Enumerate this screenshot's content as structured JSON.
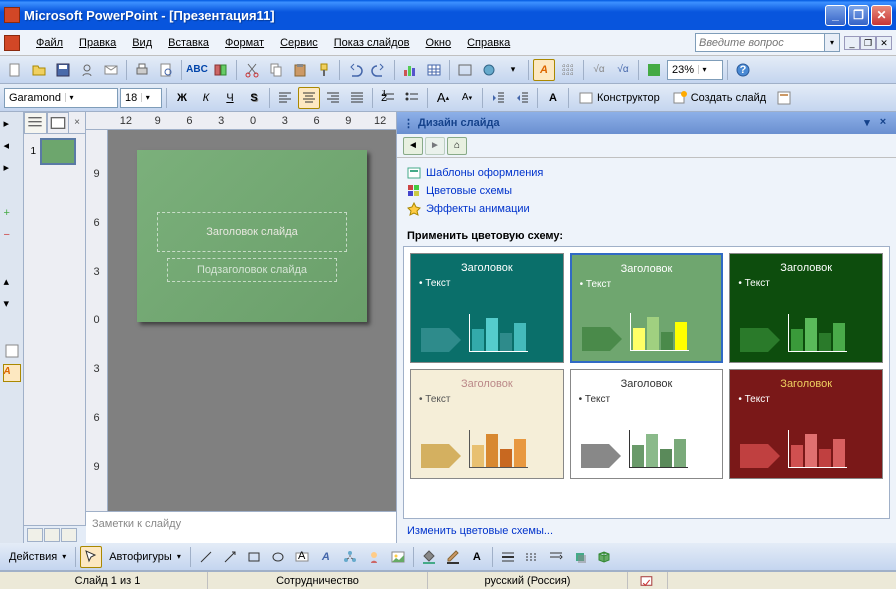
{
  "app": {
    "title": "Microsoft PowerPoint - [Презентация11]"
  },
  "menu": {
    "file": "Файл",
    "edit": "Правка",
    "view": "Вид",
    "insert": "Вставка",
    "format": "Формат",
    "service": "Сервис",
    "slideshow": "Показ слайдов",
    "window": "Окно",
    "help": "Справка"
  },
  "helpbox": {
    "placeholder": "Введите вопрос"
  },
  "toolbar": {
    "zoom": "23%",
    "constructor": "Конструктор",
    "new_slide": "Создать слайд"
  },
  "format_bar": {
    "font": "Garamond",
    "size": "18"
  },
  "ruler_h": [
    "12",
    "9",
    "6",
    "3",
    "0",
    "3",
    "6",
    "9",
    "12"
  ],
  "ruler_v": [
    "9",
    "6",
    "3",
    "0",
    "3",
    "6",
    "9"
  ],
  "outline": {
    "slide_num": "1"
  },
  "slide": {
    "title": "Заголовок слайда",
    "subtitle": "Подзаголовок слайда"
  },
  "notes": {
    "placeholder": "Заметки к слайду"
  },
  "task_pane": {
    "title": "Дизайн слайда",
    "link_templates": "Шаблоны оформления",
    "link_colors": "Цветовые схемы",
    "link_effects": "Эффекты анимации",
    "section": "Применить цветовую схему:",
    "footer": "Изменить цветовые схемы..."
  },
  "schemes": [
    {
      "bg": "#0a6f6a",
      "title_color": "#fff",
      "text_color": "#fff",
      "accent": "#2e8b8b",
      "bar_colors": [
        "#3aa",
        "#5cc",
        "#2e8b8b",
        "#4bb"
      ],
      "title": "Заголовок",
      "text": "Текст"
    },
    {
      "bg": "#6fa66f",
      "title_color": "#fff",
      "text_color": "#fff",
      "accent": "#4a8a4a",
      "bar_colors": [
        "#ffff66",
        "#a0d080",
        "#4a8a4a",
        "#ffff00"
      ],
      "title": "Заголовок",
      "text": "Текст",
      "selected": true
    },
    {
      "bg": "#0d4d0d",
      "title_color": "#fff",
      "text_color": "#fff",
      "accent": "#2a7a2a",
      "bar_colors": [
        "#3a9a3a",
        "#5aba5a",
        "#2a7a2a",
        "#4aaa4a"
      ],
      "title": "Заголовок",
      "text": "Текст"
    },
    {
      "bg": "#f5eed8",
      "title_color": "#b88",
      "text_color": "#555",
      "accent": "#d4b060",
      "bar_colors": [
        "#e8c070",
        "#d88830",
        "#c86820",
        "#e89840"
      ],
      "title": "Заголовок",
      "text": "Текст"
    },
    {
      "bg": "#ffffff",
      "title_color": "#333",
      "text_color": "#333",
      "accent": "#888",
      "bar_colors": [
        "#6a9a6a",
        "#8aba8a",
        "#5a8a5a",
        "#7aaa7a"
      ],
      "title": "Заголовок",
      "text": "Текст"
    },
    {
      "bg": "#7a1818",
      "title_color": "#f0d060",
      "text_color": "#fff",
      "accent": "#c04040",
      "bar_colors": [
        "#d05050",
        "#e07070",
        "#c04040",
        "#d86060"
      ],
      "title": "Заголовок",
      "text": "Текст"
    }
  ],
  "status": {
    "slide": "Слайд 1 из 1",
    "template": "Сотрудничество",
    "lang": "русский (Россия)"
  },
  "drawing": {
    "actions": "Действия",
    "autoshapes": "Автофигуры"
  }
}
